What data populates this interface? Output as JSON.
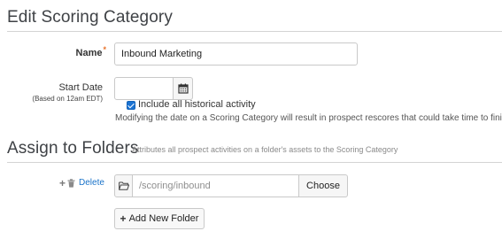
{
  "edit_section": {
    "title": "Edit Scoring Category"
  },
  "name_field": {
    "label": "Name",
    "required_marker": "*",
    "value": "Inbound Marketing"
  },
  "start_date": {
    "label": "Start Date",
    "sublabel": "(Based on 12am EDT)",
    "value": "",
    "include_historical": {
      "label": "Include all historical activity",
      "checked": true
    },
    "help_text": "Modifying the date on a Scoring Category will result in prospect rescores that could take time to finish."
  },
  "folders_section": {
    "title": "Assign to Folders",
    "subtitle": "Attributes all prospect activities on a folder's assets to the Scoring Category",
    "folder_row": {
      "delete_label": "Delete",
      "path_placeholder": "/scoring/inbound",
      "choose_label": "Choose"
    },
    "add_button_label": "Add New Folder"
  },
  "icons": {
    "calendar": "calendar-icon",
    "folder": "folder-open-icon",
    "plus": "plus-icon",
    "trash": "trash-icon"
  },
  "colors": {
    "link": "#1a73c9",
    "required": "#e8722a",
    "checkbox": "#1b73d3"
  }
}
